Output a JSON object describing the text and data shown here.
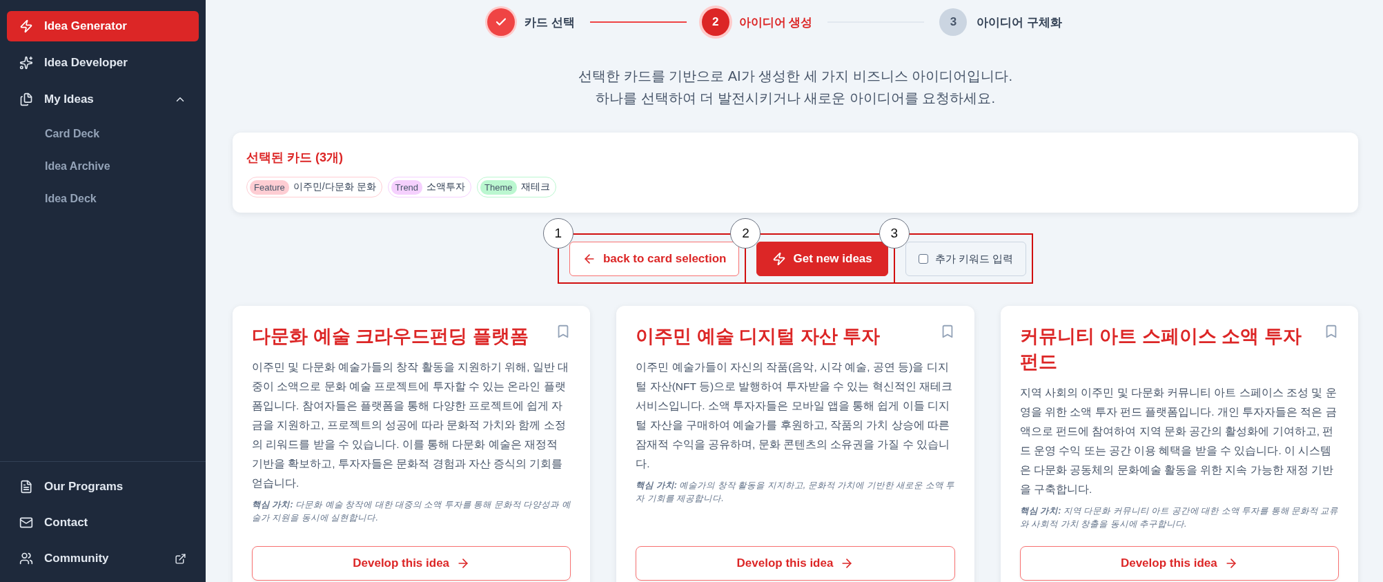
{
  "sidebar": {
    "nav": [
      {
        "label": "Idea Generator",
        "selected": true
      },
      {
        "label": "Idea Developer",
        "selected": false
      },
      {
        "label": "My Ideas",
        "selected": false,
        "expanded": true,
        "children": [
          {
            "label": "Card Deck",
            "selected": false
          },
          {
            "label": "Idea Archive",
            "selected": false
          },
          {
            "label": "Idea Deck",
            "selected": false
          }
        ]
      }
    ],
    "footer": [
      {
        "label": "Our Programs"
      },
      {
        "label": "Contact"
      },
      {
        "label": "Community"
      }
    ]
  },
  "stepper": [
    {
      "label": "카드 선택",
      "kind": "done"
    },
    {
      "number": "2",
      "label": "아이디어 생성",
      "kind": "current"
    },
    {
      "number": "3",
      "label": "아이디어 구체화",
      "kind": "upcoming"
    }
  ],
  "intro": [
    "선택한 카드를 기반으로 AI가 생성한 세 가지 비즈니스 아이디어입니다.",
    "하나를 선택하여 더 발전시키거나 새로운 아이디어를 요청하세요."
  ],
  "selected_cards": {
    "title": "선택된 카드 (3개)",
    "tags": [
      {
        "category": "Feature",
        "value": "이주민/다문화 문화",
        "color": "#fecdd3"
      },
      {
        "category": "Trend",
        "value": "소액투자",
        "color": "#f5d0fe"
      },
      {
        "category": "Theme",
        "value": "재테크",
        "color": "#bbf7d0"
      }
    ]
  },
  "actions": [
    {
      "callout": "1",
      "kind": "back",
      "label": "back to card selection"
    },
    {
      "callout": "2",
      "kind": "primary",
      "label": "Get new ideas"
    },
    {
      "callout": "3",
      "kind": "checkbox",
      "label": "추가 키워드 입력",
      "checked": false
    }
  ],
  "ideas": [
    {
      "title": "다문화 예술 크라우드펀딩 플랫폼",
      "bookmarked": false,
      "description": "이주민 및 다문화 예술가들의 창작 활동을 지원하기 위해, 일반 대중이 소액으로 문화 예술 프로젝트에 투자할 수 있는 온라인 플랫폼입니다. 참여자들은 플랫폼을 통해 다양한 프로젝트에 쉽게 자금을 지원하고, 프로젝트의 성공에 따라 문화적 가치와 함께 소정의 리워드를 받을 수 있습니다. 이를 통해 다문화 예술은 재정적 기반을 확보하고, 투자자들은 문화적 경험과 자산 증식의 기회를 얻습니다.",
      "core_value": "**핵심 가치:** 다문화 예술 창작에 대한 대중의 소액 투자를 통해 문화적 다양성과 예술가 지원을 동시에 실현합니다.",
      "button": "Develop this idea"
    },
    {
      "title": "이주민 예술 디지털 자산 투자",
      "bookmarked": false,
      "description": "이주민 예술가들이 자신의 작품(음악, 시각 예술, 공연 등)을 디지털 자산(NFT 등)으로 발행하여 투자받을 수 있는 혁신적인 재테크 서비스입니다. 소액 투자자들은 모바일 앱을 통해 쉽게 이들 디지털 자산을 구매하여 예술가를 후원하고, 작품의 가치 상승에 따른 잠재적 수익을 공유하며, 문화 콘텐츠의 소유권을 가질 수 있습니다.",
      "core_value": "**핵심 가치:** 예술가의 창작 활동을 지지하고, 문화적 가치에 기반한 새로운 소액 투자 기회를 제공합니다.",
      "button": "Develop this idea"
    },
    {
      "title": "커뮤니티 아트 스페이스 소액 투자 펀드",
      "bookmarked": false,
      "description": "지역 사회의 이주민 및 다문화 커뮤니티 아트 스페이스 조성 및 운영을 위한 소액 투자 펀드 플랫폼입니다. 개인 투자자들은 적은 금액으로 펀드에 참여하여 지역 문화 공간의 활성화에 기여하고, 펀드 운영 수익 또는 공간 이용 혜택을 받을 수 있습니다. 이 시스템은 다문화 공동체의 문화예술 활동을 위한 지속 가능한 재정 기반을 구축합니다.",
      "core_value": "**핵심 가치:** 지역 다문화 커뮤니티 아트 공간에 대한 소액 투자를 통해 문화적 교류와 사회적 가치 창출을 동시에 추구합니다.",
      "button": "Develop this idea"
    }
  ]
}
